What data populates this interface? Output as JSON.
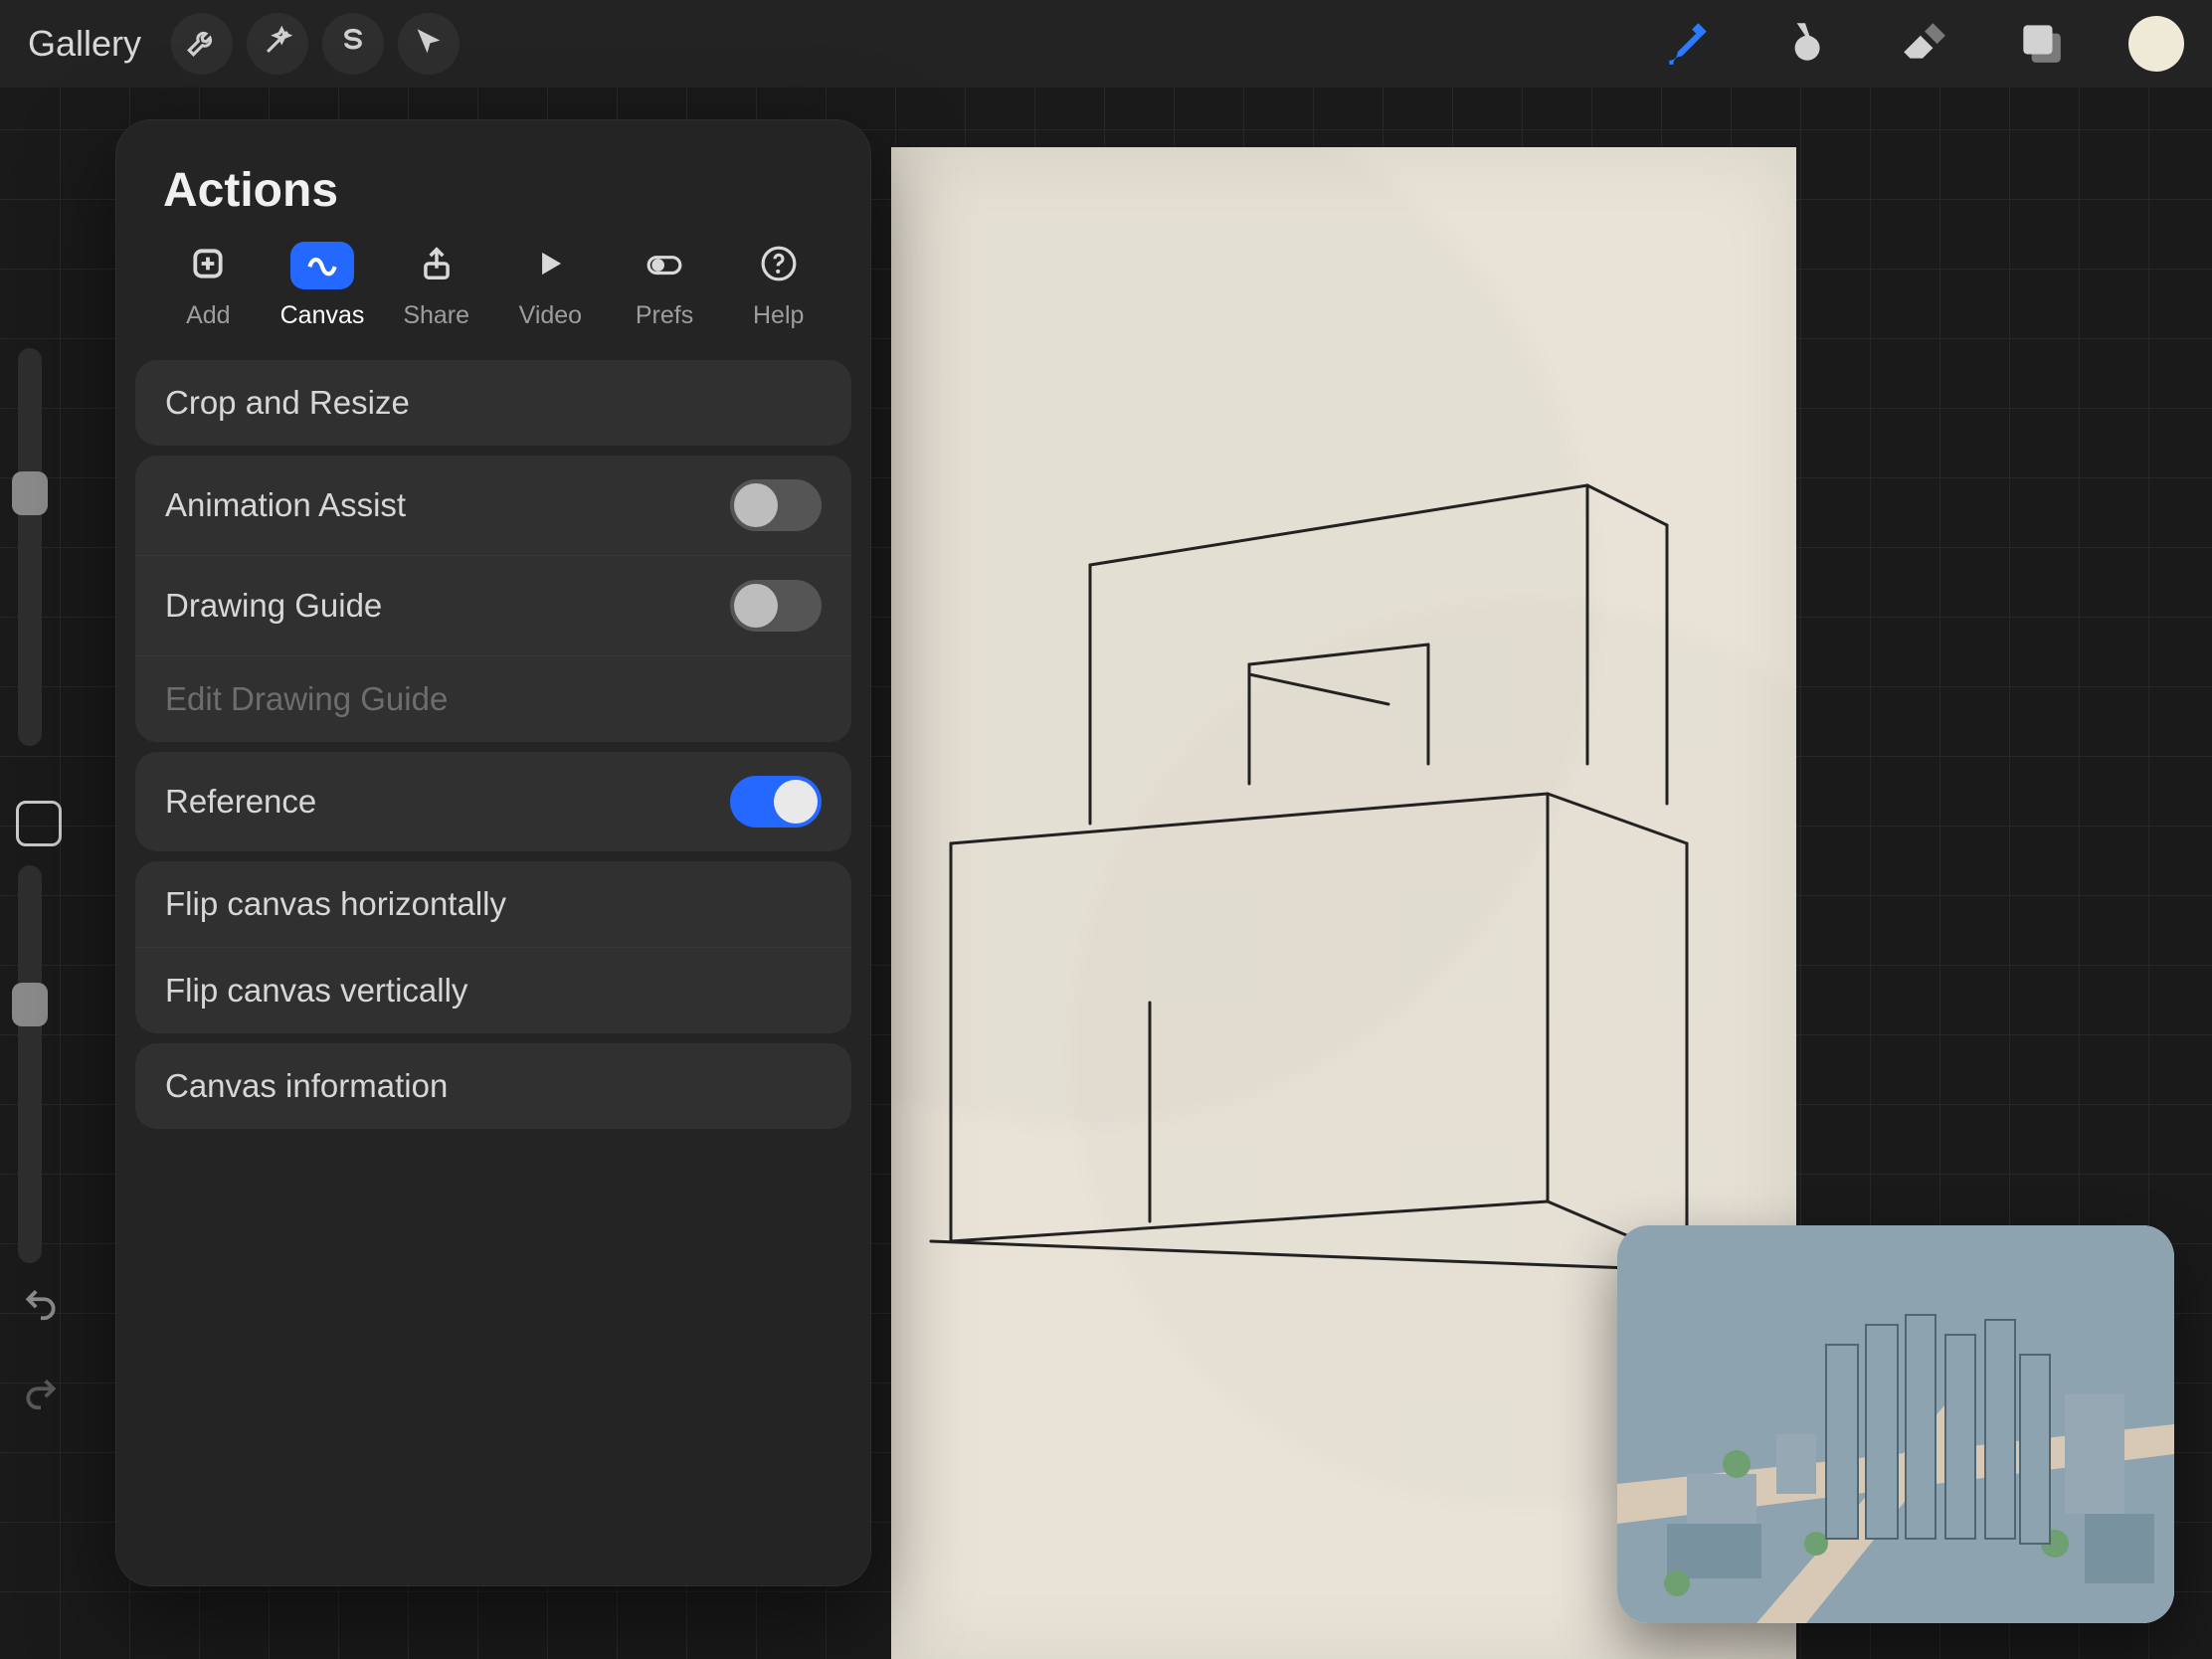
{
  "topbar": {
    "gallery": "Gallery"
  },
  "actions": {
    "title": "Actions",
    "tabs": [
      {
        "key": "add",
        "label": "Add"
      },
      {
        "key": "canvas",
        "label": "Canvas"
      },
      {
        "key": "share",
        "label": "Share"
      },
      {
        "key": "video",
        "label": "Video"
      },
      {
        "key": "prefs",
        "label": "Prefs"
      },
      {
        "key": "help",
        "label": "Help"
      }
    ],
    "rows": {
      "crop": "Crop and Resize",
      "animAssist": "Animation Assist",
      "drawGuide": "Drawing Guide",
      "editGuide": "Edit Drawing Guide",
      "reference": "Reference",
      "flipH": "Flip canvas horizontally",
      "flipV": "Flip canvas vertically",
      "canvasInfo": "Canvas information"
    },
    "toggles": {
      "animAssist": false,
      "drawGuide": false,
      "reference": true
    }
  }
}
